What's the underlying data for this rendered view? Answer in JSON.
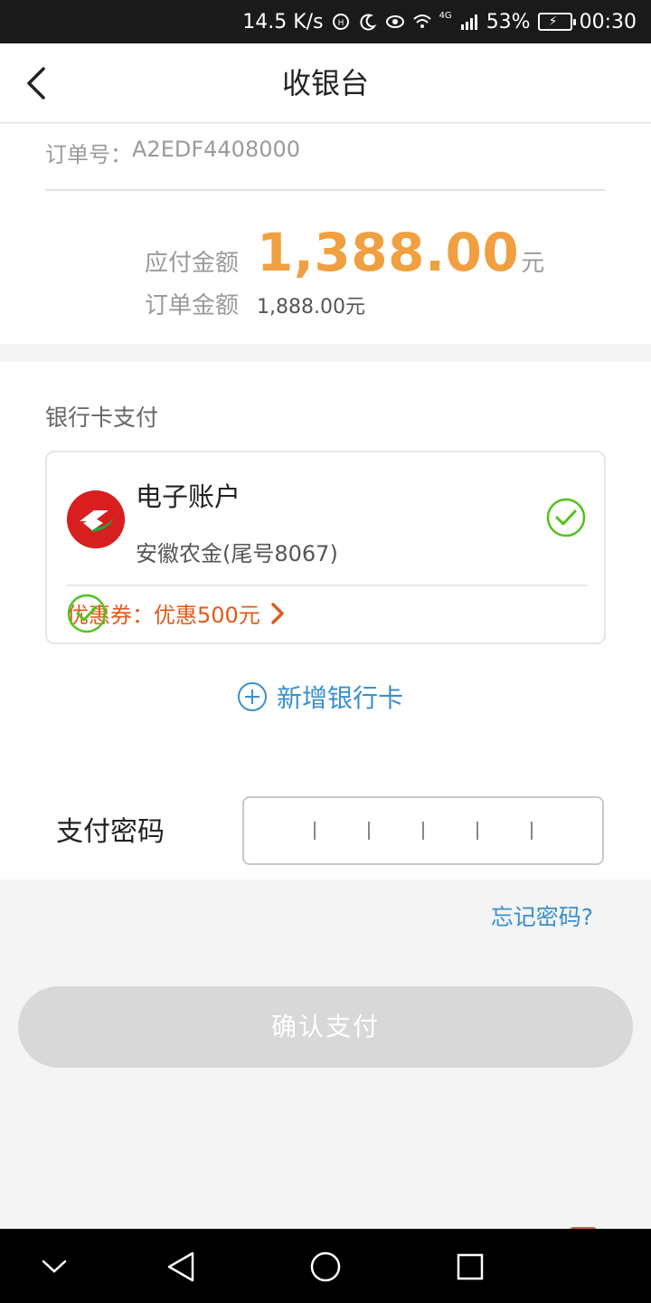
{
  "status_bar": {
    "speed": "14.5 K/s",
    "network": "4G",
    "battery": "53%",
    "time": "00:30"
  },
  "header": {
    "title": "收银台"
  },
  "order": {
    "order_no_label": "订单号：",
    "order_no": "A2EDF4408000",
    "payable_label": "应付金额",
    "payable_value": "1,388.00",
    "payable_unit": "元",
    "order_amount_label": "订单金额",
    "order_amount_value": "1,888.00",
    "order_amount_unit": "元"
  },
  "payment": {
    "section_title": "银行卡支付",
    "card": {
      "name": "电子账户",
      "detail": "安徽农金(尾号8067)",
      "selected": true
    },
    "coupon": {
      "label": "优惠券：",
      "value": "优惠500元",
      "selected": true
    },
    "add_card_label": "新增银行卡"
  },
  "password": {
    "label": "支付密码",
    "digits": 6
  },
  "forgot_label": "忘记密码?",
  "confirm_label": "确认支付",
  "colors": {
    "accent_orange": "#f0a040",
    "coupon_red": "#e05a1c",
    "link_blue": "#3a8fd0",
    "check_green": "#52c41a",
    "disabled_gray": "#d8d8d8"
  }
}
